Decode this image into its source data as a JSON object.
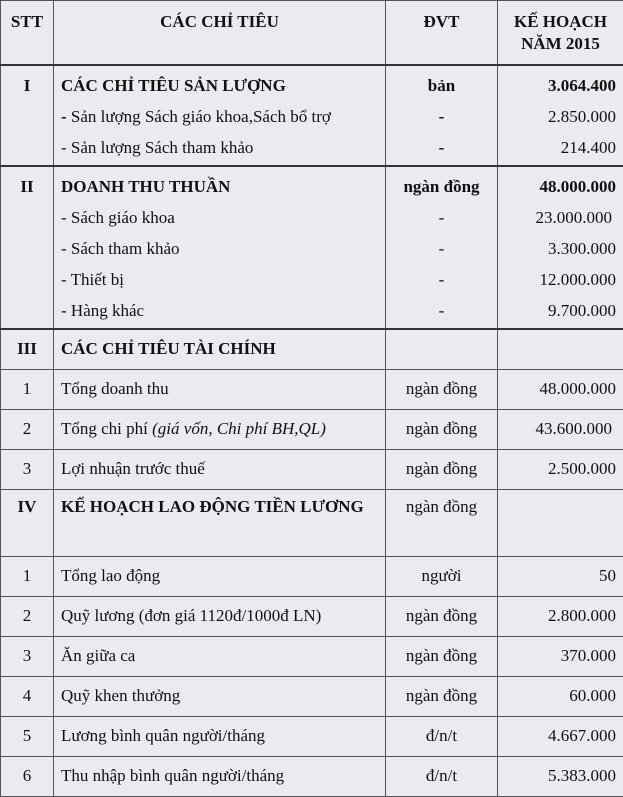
{
  "header": {
    "stt": "STT",
    "chi_tieu": "CÁC CHỈ TIÊU",
    "dvt": "ĐVT",
    "ke_hoach_line1": "KẾ HOẠCH",
    "ke_hoach_line2": "NĂM 2015"
  },
  "section1": {
    "stt": "I",
    "title": "CÁC CHỈ TIÊU SẢN LƯỢNG",
    "dvt": "bản",
    "value": "3.064.400",
    "items": [
      {
        "dash": "-",
        "label": " Sản lượng Sách giáo khoa,Sách bổ trợ",
        "dvt": "-",
        "value": "2.850.000"
      },
      {
        "dash": "-",
        "label": " Sản lượng Sách tham khảo",
        "dvt": "-",
        "value": "214.400"
      }
    ]
  },
  "section2": {
    "stt": "II",
    "title": "DOANH THU THUẦN",
    "dvt": "ngàn đồng",
    "value": "48.000.000",
    "items": [
      {
        "label": "- Sách giáo khoa",
        "dvt": "-",
        "value": "23.000.000"
      },
      {
        "label": "- Sách tham khảo",
        "dvt": "-",
        "value": "3.300.000"
      },
      {
        "label": "- Thiết bị",
        "dvt": "-",
        "value": "12.000.000"
      },
      {
        "label": "- Hàng khác",
        "dvt": "-",
        "value": "9.700.000"
      }
    ]
  },
  "section3": {
    "stt": "III",
    "title": "CÁC CHỈ TIÊU TÀI CHÍNH",
    "rows": [
      {
        "stt": "1",
        "label": "Tổng doanh thu",
        "dvt": "ngàn đồng",
        "value": "48.000.000"
      },
      {
        "stt": "2",
        "label": "Tổng chi phí ",
        "label_italic": "(giá vốn, Chi phí BH,QL)",
        "dvt": "ngàn đồng",
        "value": "43.600.000"
      },
      {
        "stt": "3",
        "label": "Lợi nhuận trước thuế",
        "dvt": "ngàn đồng",
        "value": "2.500.000"
      }
    ]
  },
  "section4": {
    "stt": "IV",
    "title": "KẾ HOẠCH LAO ĐỘNG TIỀN LƯƠNG",
    "dvt": "ngàn đồng",
    "rows": [
      {
        "stt": "1",
        "label": "Tổng lao động",
        "dvt": "người",
        "value": "50"
      },
      {
        "stt": "2",
        "label": "Quỹ lương (đơn giá 1120đ/1000đ LN)",
        "dvt": "ngàn đồng",
        "value": "2.800.000"
      },
      {
        "stt": "3",
        "label": "Ăn giữa ca",
        "dvt": "ngàn đồng",
        "value": "370.000"
      },
      {
        "stt": "4",
        "label": "Quỹ khen thưởng",
        "dvt": "ngàn đồng",
        "value": "60.000"
      },
      {
        "stt": "5",
        "label": "Lương bình quân người/tháng",
        "dvt": "đ/n/t",
        "value": "4.667.000"
      },
      {
        "stt": "6",
        "label": "Thu nhập bình quân người/tháng",
        "dvt": "đ/n/t",
        "value": "5.383.000"
      }
    ]
  }
}
